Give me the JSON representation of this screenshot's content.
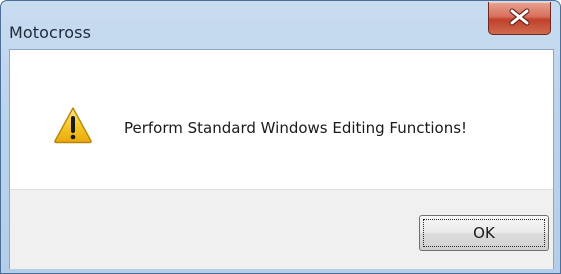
{
  "window": {
    "title": "Motocross",
    "close_icon": "close-icon"
  },
  "message": {
    "icon": "warning-icon",
    "text": "Perform Standard Windows Editing Functions!"
  },
  "buttons": {
    "ok_label": "OK"
  },
  "colors": {
    "titlebar": "#bcd3ec",
    "close_button": "#c94a32",
    "button_area": "#f0f0f0",
    "warning_yellow": "#f2c21a"
  }
}
